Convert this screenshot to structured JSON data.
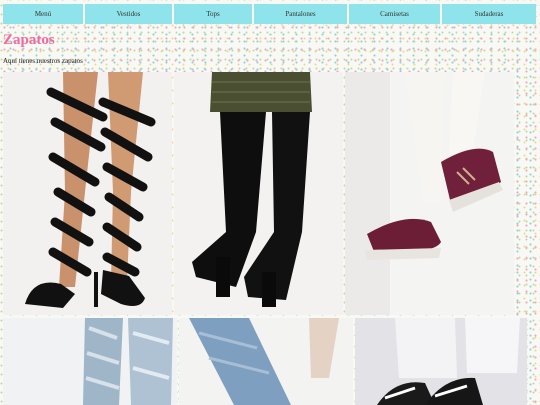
{
  "nav": {
    "items": [
      {
        "label": "Menú"
      },
      {
        "label": "Vestidos"
      },
      {
        "label": "Tops"
      },
      {
        "label": "Pantalones"
      },
      {
        "label": "Camisetas"
      },
      {
        "label": "Sudaderas"
      }
    ]
  },
  "page": {
    "title": "Zapatos",
    "subtitle": "Aquí tienes nuestros zapatos"
  },
  "colors": {
    "nav_background": "#8fe3ea",
    "title": "#f06aa0"
  }
}
